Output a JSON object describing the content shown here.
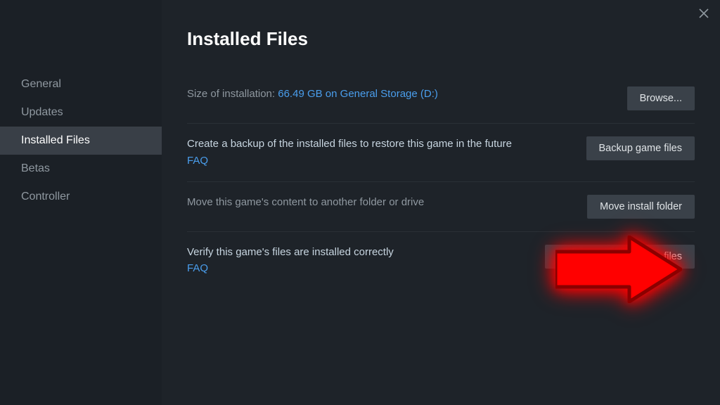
{
  "sidebar": {
    "items": [
      {
        "label": "General"
      },
      {
        "label": "Updates"
      },
      {
        "label": "Installed Files"
      },
      {
        "label": "Betas"
      },
      {
        "label": "Controller"
      }
    ],
    "active_index": 2
  },
  "header": {
    "title": "Installed Files"
  },
  "rows": {
    "size": {
      "label": "Size of installation: ",
      "value": "66.49 GB on General Storage (D:)",
      "button": "Browse..."
    },
    "backup": {
      "text": "Create a backup of the installed files to restore this game in the future",
      "faq": "FAQ",
      "button": "Backup game files"
    },
    "move": {
      "text": "Move this game's content to another folder or drive",
      "button": "Move install folder"
    },
    "verify": {
      "text": "Verify this game's files are installed correctly",
      "faq": "FAQ",
      "button": "Verify integrity of game files"
    }
  }
}
